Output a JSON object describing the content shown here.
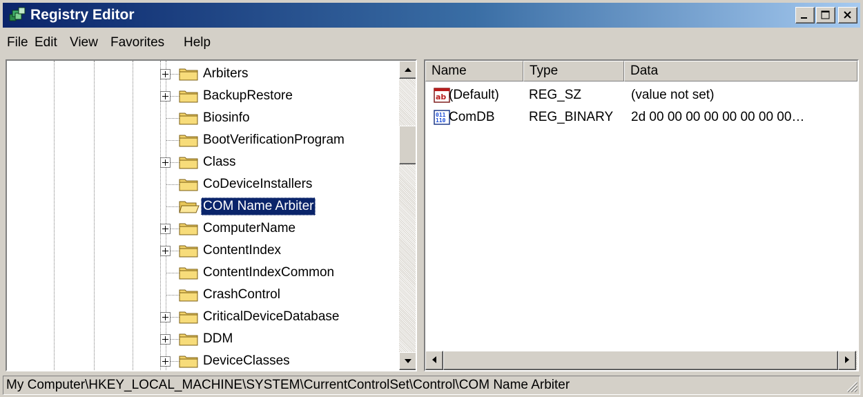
{
  "window": {
    "title": "Registry Editor",
    "caption_buttons": [
      "minimize-icon",
      "maximize-icon",
      "close-icon"
    ]
  },
  "menu": [
    {
      "label": "File"
    },
    {
      "label": "Edit"
    },
    {
      "label": "View"
    },
    {
      "label": "Favorites"
    },
    {
      "label": "Help"
    }
  ],
  "tree": {
    "items": [
      {
        "label": "Arbiters",
        "expandable": true,
        "selected": false
      },
      {
        "label": "BackupRestore",
        "expandable": true,
        "selected": false
      },
      {
        "label": "Biosinfo",
        "expandable": false,
        "selected": false
      },
      {
        "label": "BootVerificationProgram",
        "expandable": false,
        "selected": false
      },
      {
        "label": "Class",
        "expandable": true,
        "selected": false
      },
      {
        "label": "CoDeviceInstallers",
        "expandable": false,
        "selected": false
      },
      {
        "label": "COM Name Arbiter",
        "expandable": false,
        "selected": true
      },
      {
        "label": "ComputerName",
        "expandable": true,
        "selected": false
      },
      {
        "label": "ContentIndex",
        "expandable": true,
        "selected": false
      },
      {
        "label": "ContentIndexCommon",
        "expandable": false,
        "selected": false
      },
      {
        "label": "CrashControl",
        "expandable": false,
        "selected": false
      },
      {
        "label": "CriticalDeviceDatabase",
        "expandable": true,
        "selected": false
      },
      {
        "label": "DDM",
        "expandable": true,
        "selected": false
      },
      {
        "label": "DeviceClasses",
        "expandable": true,
        "selected": false
      }
    ]
  },
  "list": {
    "columns": [
      "Name",
      "Type",
      "Data"
    ],
    "rows": [
      {
        "icon": "string-value-icon",
        "name": "(Default)",
        "type": "REG_SZ",
        "data": "(value not set)"
      },
      {
        "icon": "binary-value-icon",
        "name": "ComDB",
        "type": "REG_BINARY",
        "data": "2d 00 00 00 00 00 00 00 00…"
      }
    ]
  },
  "status": {
    "path": "My Computer\\HKEY_LOCAL_MACHINE\\SYSTEM\\CurrentControlSet\\Control\\COM Name Arbiter"
  },
  "colors": {
    "title_gradient_start": "#0a246a",
    "title_gradient_end": "#a6caf0",
    "selection": "#0a246a",
    "face": "#d4d0c8"
  }
}
